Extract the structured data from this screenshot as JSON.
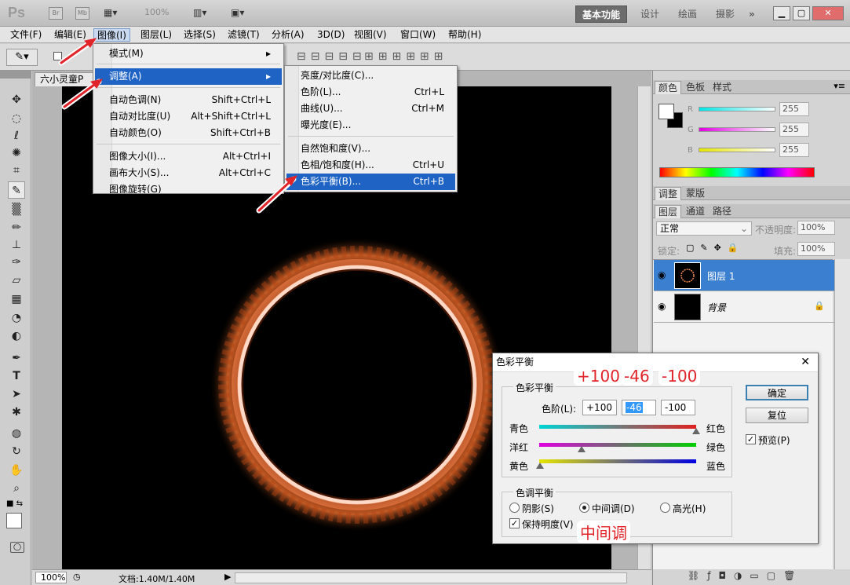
{
  "app": {
    "logo": "Ps",
    "bridge": "Br",
    "minibridge": "Mb",
    "zoom": "100%"
  },
  "workspaces": [
    {
      "label": "基本功能",
      "active": true
    },
    {
      "label": "设计",
      "active": false
    },
    {
      "label": "绘画",
      "active": false
    },
    {
      "label": "摄影",
      "active": false
    }
  ],
  "workspace_more": "»",
  "menu": [
    {
      "label": "文件(F)"
    },
    {
      "label": "编辑(E)"
    },
    {
      "label": "图像(I)"
    },
    {
      "label": "图层(L)"
    },
    {
      "label": "选择(S)"
    },
    {
      "label": "滤镜(T)"
    },
    {
      "label": "分析(A)"
    },
    {
      "label": "3D(D)"
    },
    {
      "label": "视图(V)"
    },
    {
      "label": "窗口(W)"
    },
    {
      "label": "帮助(H)"
    }
  ],
  "doc_tab": {
    "title": "六小灵童P"
  },
  "image_menu": {
    "items": [
      {
        "label": "模式(M)",
        "shortcut": "▸"
      },
      {
        "label": "调整(A)",
        "shortcut": "▸"
      },
      {
        "label": "自动色调(N)",
        "shortcut": "Shift+Ctrl+L"
      },
      {
        "label": "自动对比度(U)",
        "shortcut": "Alt+Shift+Ctrl+L"
      },
      {
        "label": "自动颜色(O)",
        "shortcut": "Shift+Ctrl+B"
      },
      {
        "label": "图像大小(I)...",
        "shortcut": "Alt+Ctrl+I"
      },
      {
        "label": "画布大小(S)...",
        "shortcut": "Alt+Ctrl+C"
      },
      {
        "label": "图像旋转(G)",
        "shortcut": ""
      }
    ]
  },
  "adjust_menu": {
    "items": [
      {
        "label": "亮度/对比度(C)...",
        "shortcut": ""
      },
      {
        "label": "色阶(L)...",
        "shortcut": "Ctrl+L"
      },
      {
        "label": "曲线(U)...",
        "shortcut": "Ctrl+M"
      },
      {
        "label": "曝光度(E)...",
        "shortcut": ""
      },
      {
        "label": "自然饱和度(V)...",
        "shortcut": ""
      },
      {
        "label": "色相/饱和度(H)...",
        "shortcut": "Ctrl+U"
      },
      {
        "label": "色彩平衡(B)...",
        "shortcut": "Ctrl+B"
      }
    ]
  },
  "color_panel": {
    "tabs": [
      "颜色",
      "色板",
      "样式"
    ],
    "channels": [
      {
        "label": "R",
        "value": "255",
        "color": "#00e5e5"
      },
      {
        "label": "G",
        "value": "255",
        "color": "#e000e0"
      },
      {
        "label": "B",
        "value": "255",
        "color": "#e5e500"
      }
    ]
  },
  "adjust_panel": {
    "tabs": [
      "调整",
      "蒙版"
    ]
  },
  "layers_panel": {
    "tabs": [
      "图层",
      "通道",
      "路径"
    ],
    "blend_mode": "正常",
    "opacity_label": "不透明度:",
    "opacity": "100%",
    "lock_label": "锁定:",
    "fill_label": "填充:",
    "fill": "100%",
    "layers": [
      {
        "name": "图层 1",
        "selected": true
      },
      {
        "name": "背景",
        "selected": false
      }
    ]
  },
  "status": {
    "zoom": "100%",
    "doc_info": "文档:1.40M/1.40M"
  },
  "dialog": {
    "title": "色彩平衡",
    "close": "✕",
    "balance_group": "色彩平衡",
    "levels_label": "色阶(L):",
    "levels": [
      "+100",
      "-46",
      "-100"
    ],
    "sliders": [
      {
        "left": "青色",
        "right": "红色",
        "value": 100
      },
      {
        "left": "洋红",
        "right": "绿色",
        "value": -46
      },
      {
        "left": "黄色",
        "right": "蓝色",
        "value": -100
      }
    ],
    "tone_group": "色调平衡",
    "tones": [
      {
        "label": "阴影(S)",
        "checked": false
      },
      {
        "label": "中间调(D)",
        "checked": true
      },
      {
        "label": "高光(H)",
        "checked": false
      }
    ],
    "preserve_label": "保持明度(V)",
    "ok": "确定",
    "reset": "复位",
    "preview": "预览(P)"
  },
  "annotations": {
    "levels": [
      "+100",
      "-46",
      "-100"
    ],
    "midtone": "中间调"
  },
  "colors": {
    "accent": "#1f64c4",
    "annotation": "#e0242a"
  }
}
